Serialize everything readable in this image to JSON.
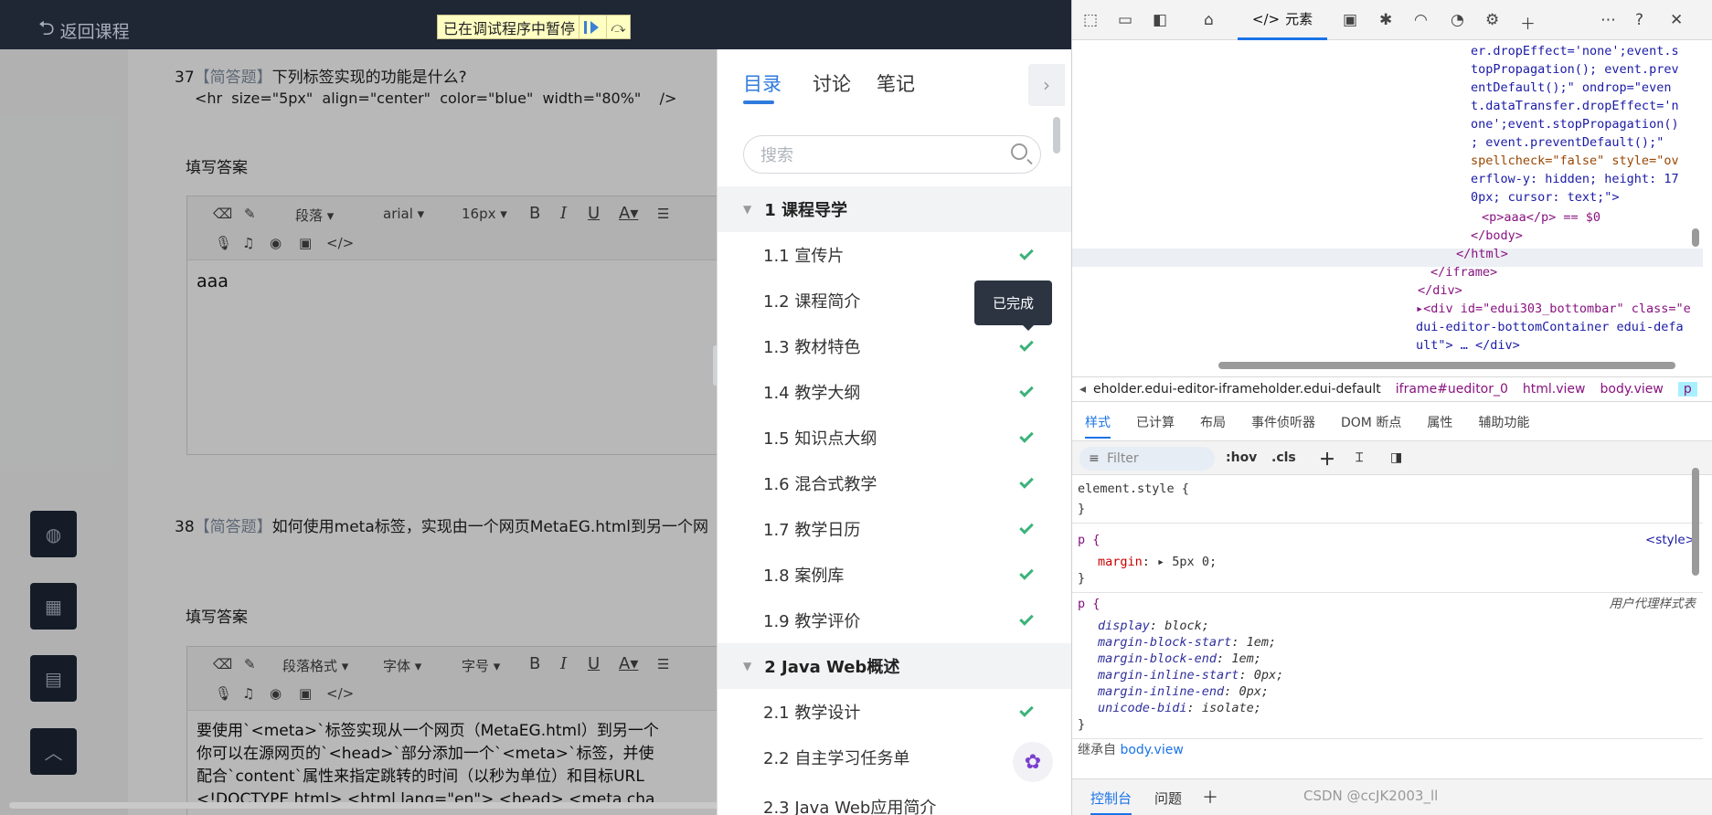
{
  "app": {
    "back_label": "返回课程",
    "pause_banner": "已在调试程序中暂停"
  },
  "questions": [
    {
      "number": "37",
      "type": "【简答题】",
      "text": "下列标签实现的功能是什么?",
      "code": "<hr  size=\"5px\"  align=\"center\"  color=\"blue\"  width=\"80%\"    />",
      "fill_label": "填写答案",
      "toolbar": {
        "para": "段落",
        "font": "arial",
        "size": "16px"
      },
      "answer": "aaa"
    },
    {
      "number": "38",
      "type": "【简答题】",
      "text": "如何使用meta标签，实现由一个网页MetaEG.html到另一个网",
      "fill_label": "填写答案",
      "toolbar": {
        "para": "段落格式",
        "font": "字体",
        "size": "字号"
      },
      "answer_lines": [
        "要使用`<meta>`标签实现从一个网页（MetaEG.html）到另一个",
        "你可以在源网页的`<head>`部分添加一个`<meta>`标签，并使",
        "配合`content`属性来指定跳转的时间（以秒为单位）和目标URL",
        "<!DOCTYPE html> <html lang=\"en\"> <head>   <meta cha"
      ]
    }
  ],
  "toolbar_common": {
    "bold": "B",
    "italic": "I",
    "underline": "U",
    "color": "A"
  },
  "drawer": {
    "tabs": [
      "目录",
      "讨论",
      "笔记"
    ],
    "search_placeholder": "搜索",
    "tooltip": "已完成",
    "sections": [
      {
        "title": "1 课程导学",
        "items": [
          "1.1 宣传片",
          "1.2 课程简介",
          "1.3 教材特色",
          "1.4 教学大纲",
          "1.5 知识点大纲",
          "1.6 混合式教学",
          "1.7 教学日历",
          "1.8 案例库",
          "1.9 教学评价"
        ]
      },
      {
        "title": "2 Java Web概述",
        "items": [
          "2.1 教学设计",
          "2.2 自主学习任务单",
          "2.3 Java Web应用简介"
        ]
      }
    ]
  },
  "devtools": {
    "elements_tab": "元素",
    "dom_lines": [
      "er.dropEffect='none';event.s",
      "topPropagation(); event.prev",
      "entDefault();\" ondrop=\"even",
      "t.dataTransfer.dropEffect='n",
      "one';event.stopPropagation()",
      "; event.preventDefault();\"",
      "spellcheck=\"false\" style=\"ov",
      "erflow-y: hidden; height: 17",
      "0px; cursor: text;\">"
    ],
    "selected_line": "<p>aaa</p> == $0",
    "close_lines": [
      "</body>",
      "</html>",
      "</iframe>",
      "</div>"
    ],
    "bottombar_lines": [
      "<div id=\"edui303_bottombar\" class=\"e",
      "dui-editor-bottomContainer edui-defa",
      "ult\"> … </div>"
    ],
    "breadcrumb": [
      "eholder.edui-editor-iframeholder.edui-default",
      "iframe#ueditor_0",
      "html.view",
      "body.view",
      "p"
    ],
    "style_tabs": [
      "样式",
      "已计算",
      "布局",
      "事件侦听器",
      "DOM 断点",
      "属性",
      "辅助功能"
    ],
    "filter_placeholder": "Filter",
    "hov": ":hov",
    "cls": ".cls",
    "rules": {
      "element_style": "element.style {",
      "p_selector": "p {",
      "p_source": "<style>",
      "p_margin_name": "margin",
      "p_margin_value": "▸ 5px 0;",
      "ua_selector": "p {",
      "ua_source": "用户代理样式表",
      "ua_decls": [
        [
          "display",
          "block;"
        ],
        [
          "margin-block-start",
          "1em;"
        ],
        [
          "margin-block-end",
          "1em;"
        ],
        [
          "margin-inline-start",
          "0px;"
        ],
        [
          "margin-inline-end",
          "0px;"
        ],
        [
          "unicode-bidi",
          "isolate;"
        ]
      ],
      "inherited_prefix": "继承自 ",
      "inherited_link": "body.view"
    },
    "drawer_tabs": [
      "控制台",
      "问题"
    ],
    "watermark": "CSDN @ccJK2003_ll"
  },
  "colors": {
    "accent": "#2f7bdd",
    "check": "#3bb37a",
    "topbar": "#1f2735"
  }
}
